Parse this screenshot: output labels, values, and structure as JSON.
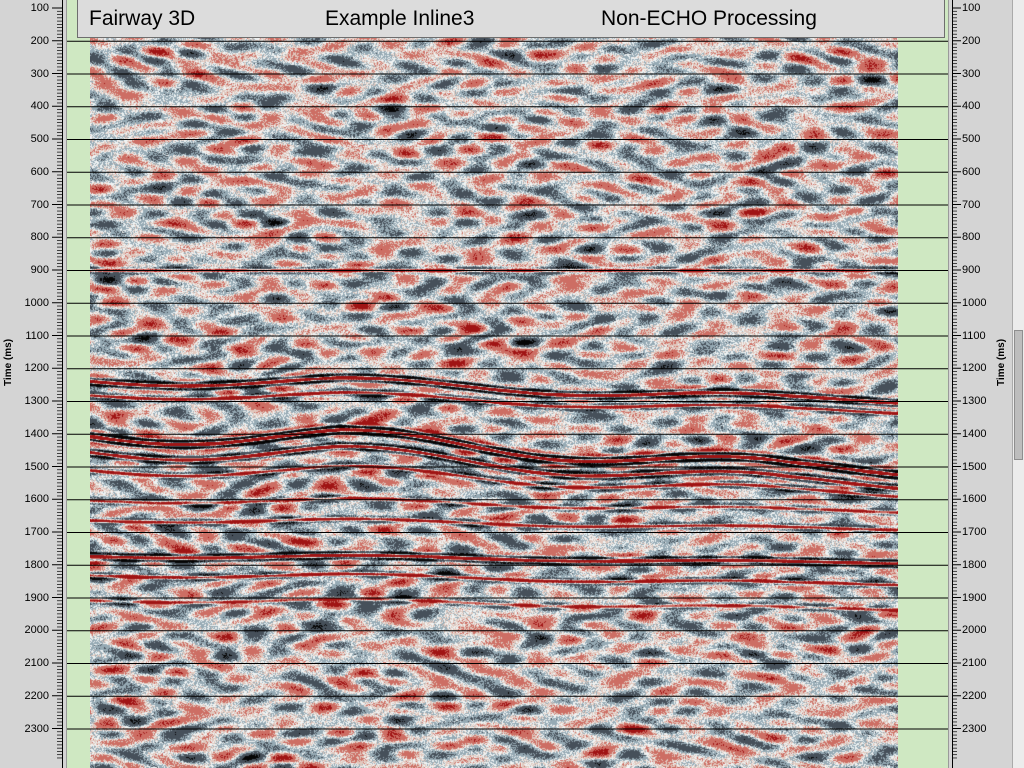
{
  "title_bar": {
    "survey": "Fairway 3D",
    "line": "Example Inline3",
    "processing": "Non-ECHO Processing"
  },
  "axis": {
    "title": "Time (ms)",
    "ticks": [
      "100",
      "200",
      "300",
      "400",
      "500",
      "600",
      "700",
      "800",
      "900",
      "1000",
      "1100",
      "1200",
      "1300",
      "1400",
      "1500",
      "1600",
      "1700",
      "1800",
      "1900",
      "2000",
      "2100",
      "2200",
      "2300"
    ]
  },
  "colors": {
    "background": "#cfe8c2",
    "positive": "#b31b1b",
    "negative": "#000000",
    "panel": "#d4d4d4"
  }
}
